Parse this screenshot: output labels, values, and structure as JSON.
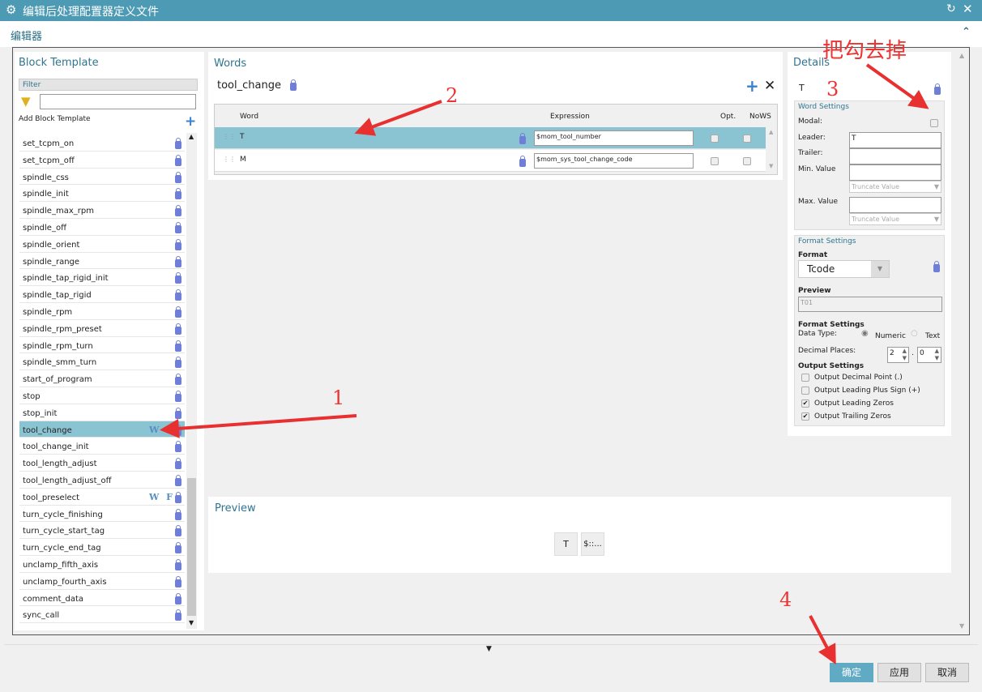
{
  "window": {
    "title": "编辑后处理配置器定义文件",
    "icon": "gear-icon"
  },
  "editor": {
    "header": "编辑器"
  },
  "block_template": {
    "title": "Block Template",
    "filter_label": "Filter",
    "filter_value": "",
    "add_label": "Add Block Template",
    "items": [
      {
        "name": "set_tcpm_on"
      },
      {
        "name": "set_tcpm_off"
      },
      {
        "name": "spindle_css"
      },
      {
        "name": "spindle_init"
      },
      {
        "name": "spindle_max_rpm"
      },
      {
        "name": "spindle_off"
      },
      {
        "name": "spindle_orient"
      },
      {
        "name": "spindle_range"
      },
      {
        "name": "spindle_tap_rigid_init"
      },
      {
        "name": "spindle_tap_rigid"
      },
      {
        "name": "spindle_rpm"
      },
      {
        "name": "spindle_rpm_preset"
      },
      {
        "name": "spindle_rpm_turn"
      },
      {
        "name": "spindle_smm_turn"
      },
      {
        "name": "start_of_program"
      },
      {
        "name": "stop"
      },
      {
        "name": "stop_init"
      },
      {
        "name": "tool_change",
        "badges": "W",
        "selected": true
      },
      {
        "name": "tool_change_init"
      },
      {
        "name": "tool_length_adjust"
      },
      {
        "name": "tool_length_adjust_off"
      },
      {
        "name": "tool_preselect",
        "badges": "W F"
      },
      {
        "name": "turn_cycle_finishing"
      },
      {
        "name": "turn_cycle_start_tag"
      },
      {
        "name": "turn_cycle_end_tag"
      },
      {
        "name": "unclamp_fifth_axis"
      },
      {
        "name": "unclamp_fourth_axis"
      },
      {
        "name": "comment_data"
      },
      {
        "name": "sync_call"
      }
    ]
  },
  "words": {
    "title": "Words",
    "block_name": "tool_change",
    "columns": [
      "Word",
      "Expression",
      "Opt.",
      "NoWS"
    ],
    "rows": [
      {
        "word": "T",
        "expression": "$mom_tool_number",
        "opt": false,
        "nows": false,
        "selected": true
      },
      {
        "word": "M",
        "expression": "$mom_sys_tool_change_code",
        "opt": false,
        "nows": false
      }
    ]
  },
  "details": {
    "title": "Details",
    "word": "T",
    "word_settings": {
      "title": "Word Settings",
      "modal_label": "Modal:",
      "modal": false,
      "leader_label": "Leader:",
      "leader": "T",
      "trailer_label": "Trailer:",
      "trailer": "",
      "min_label": "Min. Value",
      "min": "",
      "min_truncate": "Truncate Value",
      "max_label": "Max. Value",
      "max": "",
      "max_truncate": "Truncate Value"
    },
    "format_settings": {
      "title": "Format Settings",
      "format_label": "Format",
      "format_value": "Tcode",
      "preview_label": "Preview",
      "preview_value": "T01",
      "sub_title": "Format Settings",
      "data_type_label": "Data Type:",
      "numeric_label": "Numeric",
      "text_label": "Text",
      "data_type": "Numeric",
      "decimal_label": "Decimal Places:",
      "dec_left": "2",
      "dec_sep": ".",
      "dec_right": "0",
      "output_title": "Output Settings",
      "outputs": [
        {
          "label": "Output Decimal Point (.)",
          "checked": false
        },
        {
          "label": "Output Leading Plus Sign (+)",
          "checked": false
        },
        {
          "label": "Output Leading Zeros",
          "checked": true
        },
        {
          "label": "Output Trailing Zeros",
          "checked": true
        }
      ]
    }
  },
  "preview": {
    "title": "Preview",
    "tokens": [
      "T",
      "$::..."
    ]
  },
  "footer": {
    "ok": "确定",
    "apply": "应用",
    "cancel": "取消"
  },
  "annotations": {
    "n1": "1",
    "n2": "2",
    "n3": "3",
    "n4": "4",
    "note": "把勾去掉",
    "color": "#e83030"
  }
}
